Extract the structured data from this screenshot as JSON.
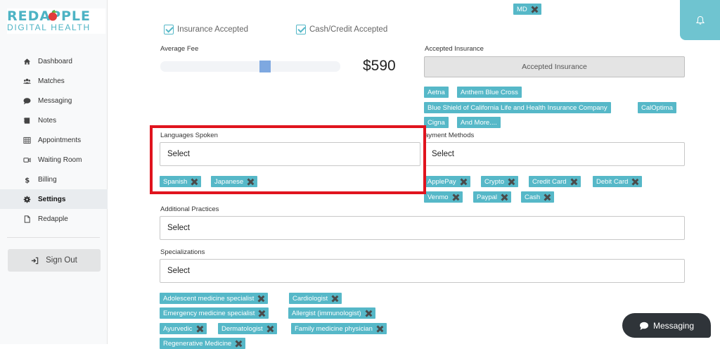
{
  "logo": {
    "top": "REDAPPLE",
    "bottom": "DIGITAL HEALTH"
  },
  "sidebar": {
    "items": [
      {
        "label": "Dashboard",
        "icon": "home-icon"
      },
      {
        "label": "Matches",
        "icon": "users-icon"
      },
      {
        "label": "Messaging",
        "icon": "comment-icon"
      },
      {
        "label": "Notes",
        "icon": "notes-icon"
      },
      {
        "label": "Appointments",
        "icon": "calendar-icon"
      },
      {
        "label": "Waiting Room",
        "icon": "video-icon"
      },
      {
        "label": "Billing",
        "icon": "dollar-icon"
      },
      {
        "label": "Settings",
        "icon": "gear-icon"
      },
      {
        "label": "Redapple",
        "icon": "document-icon"
      }
    ],
    "active": "Settings",
    "signout": "Sign Out"
  },
  "top_chip": {
    "label": "MD"
  },
  "checkboxes": {
    "insurance": "Insurance Accepted",
    "cash": "Cash/Credit Accepted"
  },
  "fee": {
    "label": "Average Fee",
    "value": "$590",
    "slider_fraction": 0.6
  },
  "insurance": {
    "label": "Accepted Insurance",
    "button": "Accepted Insurance",
    "chips": [
      "Aetna",
      "Anthem Blue Cross",
      "Blue Shield of California Life and Health Insurance Company",
      "CalOptima",
      "Cigna",
      "And More...."
    ]
  },
  "languages": {
    "label": "Languages Spoken",
    "placeholder": "Select",
    "chips": [
      "Spanish",
      "Japanese"
    ]
  },
  "payment": {
    "label": "ayment Methods",
    "placeholder": "Select",
    "chips": [
      "ApplePay",
      "Crypto",
      "Credit Card",
      "Debit Card",
      "Venmo",
      "Paypal",
      "Cash"
    ]
  },
  "practices": {
    "label": "Additional Practices",
    "placeholder": "Select"
  },
  "specializations": {
    "label": "Specializations",
    "placeholder": "Select",
    "chips": [
      "Adolescent medicine specialist",
      "Cardiologist",
      "Emergency medicine specialist",
      "Allergist (immunologist)",
      "Ayurvedic",
      "Dermatologist",
      "Family medicine physician",
      "Regenerative Medicine"
    ]
  },
  "messaging_button": "Messaging",
  "colors": {
    "accent": "#56b8c8",
    "highlight": "#e0141e",
    "dark": "#2f3439"
  }
}
